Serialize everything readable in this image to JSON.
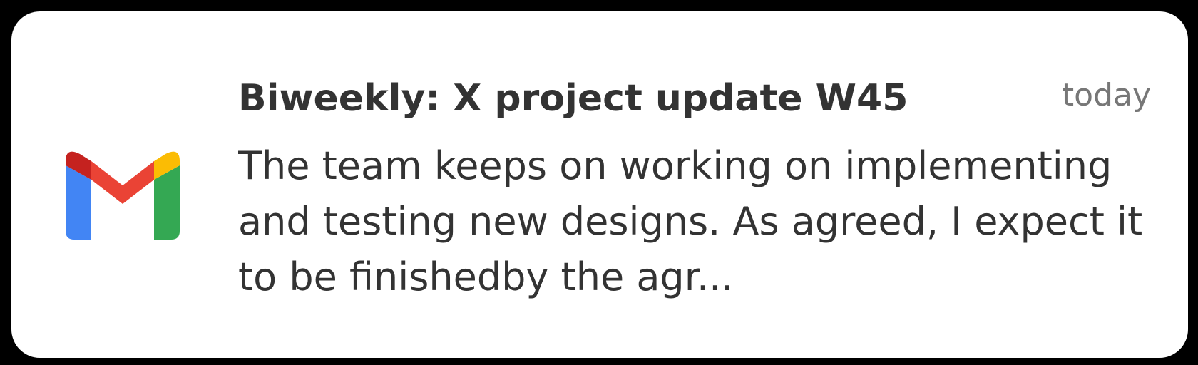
{
  "notification": {
    "app_icon": "gmail-icon",
    "title": "Biweekly: X project update W45",
    "timestamp": "today",
    "body": "The team keeps on working on implementing and testing new designs. As agreed, I expect it to be finishedby the agr..."
  },
  "colors": {
    "background": "#000000",
    "card": "#ffffff",
    "title": "#333333",
    "body": "#333333",
    "timestamp": "#777777",
    "gmail_red": "#EA4335",
    "gmail_dark_red": "#C5221F",
    "gmail_blue": "#4285F4",
    "gmail_green": "#34A853",
    "gmail_yellow": "#FBBC04"
  }
}
